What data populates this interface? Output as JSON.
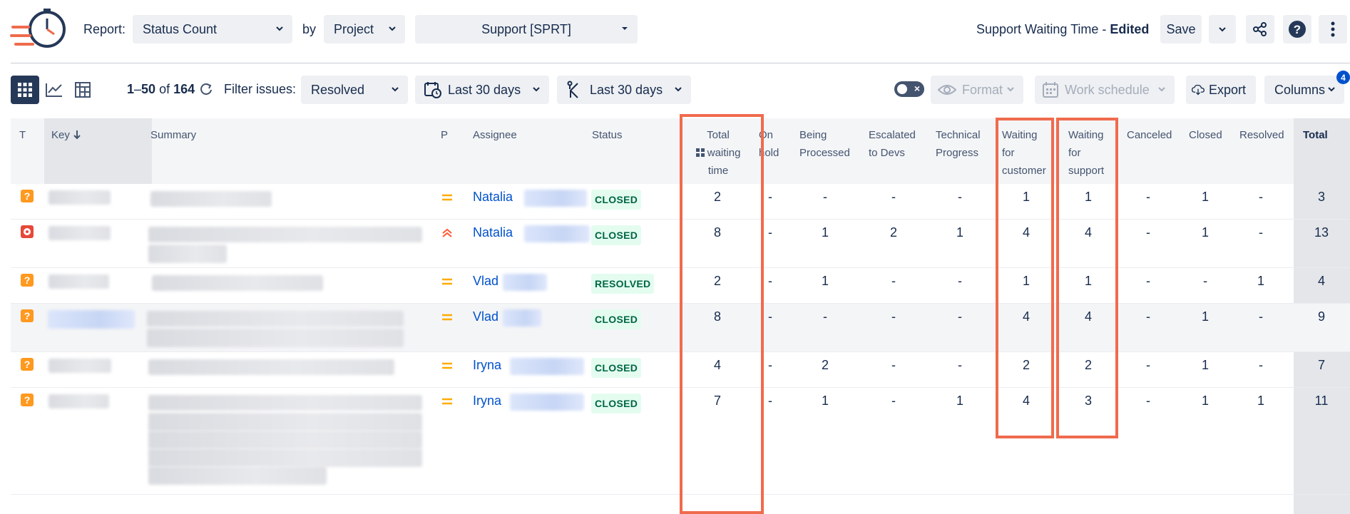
{
  "header": {
    "report_label": "Report:",
    "report_value": "Status Count",
    "by_label": "by",
    "by_value": "Project",
    "project_value": "Support [SPRT]",
    "report_name": "Support Waiting Time - ",
    "report_state": "Edited",
    "save_label": "Save"
  },
  "toolbar": {
    "range_start": "1",
    "range_sep": "–",
    "range_end": "50",
    "of_label": " of ",
    "total_count": "164",
    "filter_label": "Filter issues:",
    "filter_value": "Resolved",
    "date_filter_1": "Last 30 days",
    "date_filter_2": "Last 30 days",
    "format_label": "Format",
    "work_schedule_label": "Work schedule",
    "export_label": "Export",
    "columns_label": "Columns",
    "columns_badge": "4"
  },
  "table": {
    "headers": {
      "type": "T",
      "key": "Key",
      "summary": "Summary",
      "priority": "P",
      "assignee": "Assignee",
      "status": "Status",
      "total_waiting": [
        "Total",
        "waiting",
        "time"
      ],
      "on_hold": [
        "On",
        "hold"
      ],
      "being_processed": [
        "Being",
        "Processed"
      ],
      "escalated": [
        "Escalated",
        "to Devs"
      ],
      "technical": [
        "Technical",
        "Progress"
      ],
      "waiting_customer": [
        "Waiting",
        "for",
        "customer"
      ],
      "waiting_support": [
        "Waiting",
        "for",
        "support"
      ],
      "canceled": "Canceled",
      "closed": "Closed",
      "resolved": "Resolved",
      "total": "Total"
    },
    "rows": [
      {
        "assignee": "Natalia",
        "status": "CLOSED",
        "total_waiting": "2",
        "on_hold": "-",
        "being_processed": "-",
        "escalated": "-",
        "technical": "-",
        "waiting_customer": "1",
        "waiting_support": "1",
        "canceled": "-",
        "closed": "1",
        "resolved": "-",
        "total": "3"
      },
      {
        "assignee": "Natalia",
        "status": "CLOSED",
        "total_waiting": "8",
        "on_hold": "-",
        "being_processed": "1",
        "escalated": "2",
        "technical": "1",
        "waiting_customer": "4",
        "waiting_support": "4",
        "canceled": "-",
        "closed": "1",
        "resolved": "-",
        "total": "13"
      },
      {
        "assignee": "Vlad",
        "status": "RESOLVED",
        "total_waiting": "2",
        "on_hold": "-",
        "being_processed": "1",
        "escalated": "-",
        "technical": "-",
        "waiting_customer": "1",
        "waiting_support": "1",
        "canceled": "-",
        "closed": "-",
        "resolved": "1",
        "total": "4"
      },
      {
        "assignee": "Vlad",
        "status": "CLOSED",
        "total_waiting": "8",
        "on_hold": "-",
        "being_processed": "-",
        "escalated": "-",
        "technical": "-",
        "waiting_customer": "4",
        "waiting_support": "4",
        "canceled": "-",
        "closed": "1",
        "resolved": "-",
        "total": "9"
      },
      {
        "assignee": "Iryna",
        "status": "CLOSED",
        "total_waiting": "4",
        "on_hold": "-",
        "being_processed": "2",
        "escalated": "-",
        "technical": "-",
        "waiting_customer": "2",
        "waiting_support": "2",
        "canceled": "-",
        "closed": "1",
        "resolved": "-",
        "total": "7"
      },
      {
        "assignee": "Iryna",
        "status": "CLOSED",
        "total_waiting": "7",
        "on_hold": "-",
        "being_processed": "1",
        "escalated": "-",
        "technical": "1",
        "waiting_customer": "4",
        "waiting_support": "3",
        "canceled": "-",
        "closed": "1",
        "resolved": "1",
        "total": "11"
      }
    ]
  },
  "colors": {
    "accent": "#0052cc",
    "highlight": "#ef6b4d",
    "closed_badge_bg": "#e3fcef",
    "closed_badge_text": "#006644",
    "type_question": "#ff991f",
    "type_bug": "#e5493a",
    "priority_medium": "#ffab00",
    "priority_high": "#ff5630"
  },
  "icons": [
    "logo-stopwatch-icon",
    "chevron-down-icon",
    "share-icon",
    "help-icon",
    "more-vertical-icon",
    "grid-view-icon",
    "chart-view-icon",
    "pivot-view-icon",
    "refresh-icon",
    "calendar-icon",
    "branch-icon",
    "eye-icon",
    "calendar-schedule-icon",
    "cloud-download-icon",
    "arrow-down-icon",
    "question-type-icon",
    "bug-type-icon",
    "priority-medium-icon",
    "priority-high-icon"
  ]
}
